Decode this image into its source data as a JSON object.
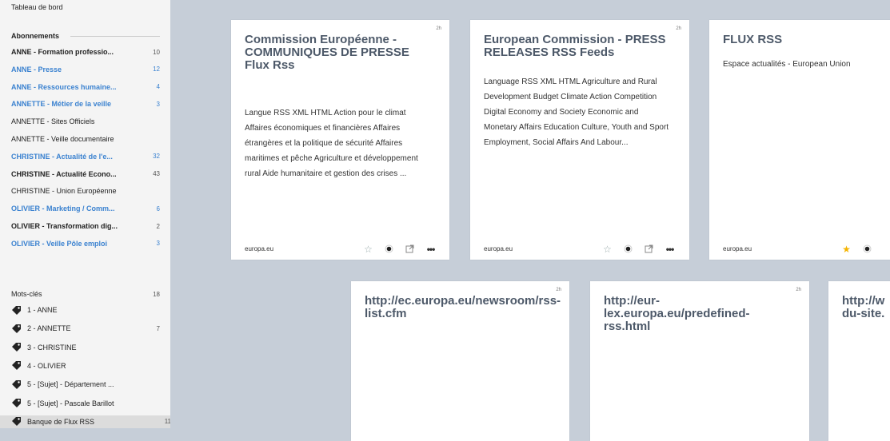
{
  "sidebar": {
    "dashboard": "Tableau de bord",
    "subscriptions_header": "Abonnements",
    "subscriptions": [
      {
        "label": "ANNE - Formation professio...",
        "count": "10",
        "style": "unread"
      },
      {
        "label": "ANNE - Presse",
        "count": "12",
        "style": "blue"
      },
      {
        "label": "ANNE - Ressources humaine...",
        "count": "4",
        "style": "blue"
      },
      {
        "label": "ANNETTE - Métier de la veille",
        "count": "3",
        "style": "blue"
      },
      {
        "label": "ANNETTE - Sites Officiels",
        "count": "",
        "style": "normal"
      },
      {
        "label": "ANNETTE - Veille documentaire",
        "count": "",
        "style": "normal"
      },
      {
        "label": "CHRISTINE - Actualité de l'e...",
        "count": "32",
        "style": "blue"
      },
      {
        "label": "CHRISTINE - Actualité Econo...",
        "count": "43",
        "style": "unread"
      },
      {
        "label": "CHRISTINE - Union Européenne",
        "count": "",
        "style": "normal"
      },
      {
        "label": "OLIVIER - Marketing / Comm...",
        "count": "6",
        "style": "blue"
      },
      {
        "label": "OLIVIER - Transformation dig...",
        "count": "2",
        "style": "unread"
      },
      {
        "label": "OLIVIER - Veille Pôle emploi",
        "count": "3",
        "style": "blue"
      }
    ],
    "tags_header": "Mots-clés",
    "tags_count": "18",
    "tags": [
      {
        "label": "1 - ANNE",
        "count": ""
      },
      {
        "label": "2 - ANNETTE",
        "count": "7"
      },
      {
        "label": "3 - CHRISTINE",
        "count": ""
      },
      {
        "label": "4 - OLIVIER",
        "count": ""
      },
      {
        "label": "5 - [Sujet] - Département ...",
        "count": ""
      },
      {
        "label": "5 - [Sujet] - Pascale Barillot",
        "count": ""
      },
      {
        "label": "Banque de Flux RSS",
        "count": "11",
        "active": true
      }
    ]
  },
  "cards": [
    {
      "age": "2h",
      "title": "Commission Européenne - COMMUNIQUES DE PRESSE Flux Rss",
      "desc": "Langue RSS XML HTML Action pour le climat Affaires économiques et financières Affaires étrangères et la politique de sécurité Affaires maritimes et pêche Agriculture et développement rural Aide humanitaire et gestion des crises ...",
      "source": "europa.eu",
      "starred": false
    },
    {
      "age": "2h",
      "title": "European Commission - PRESS RELEASES RSS Feeds",
      "desc": "Language RSS XML HTML Agriculture and Rural Development Budget Climate Action Competition Digital Economy and Society Economic and Monetary Affairs Education Culture, Youth and Sport Employment, Social Affairs And Labour...",
      "source": "europa.eu",
      "starred": false
    },
    {
      "age": "",
      "title": "FLUX RSS",
      "desc": "Espace actualités - European Union",
      "source": "europa.eu",
      "starred": true
    },
    {
      "age": "2h",
      "title": "http://ec.europa.eu/newsroom/rss-list.cfm",
      "desc": "",
      "source": "",
      "starred": false
    },
    {
      "age": "2h",
      "title": "http://eur-lex.europa.eu/predefined-rss.html",
      "desc": "",
      "source": "",
      "starred": false
    },
    {
      "age": "",
      "title": "http://w du-site.",
      "desc": "",
      "source": "",
      "starred": false
    }
  ],
  "colors": {
    "accent_blue": "#3b82d0",
    "star_active": "#f5b400",
    "title": "#4d5969"
  },
  "icons": {
    "star": "star-icon",
    "read": "radio-icon",
    "external": "external-link-icon",
    "more": "more-icon",
    "tag": "tag-icon"
  }
}
